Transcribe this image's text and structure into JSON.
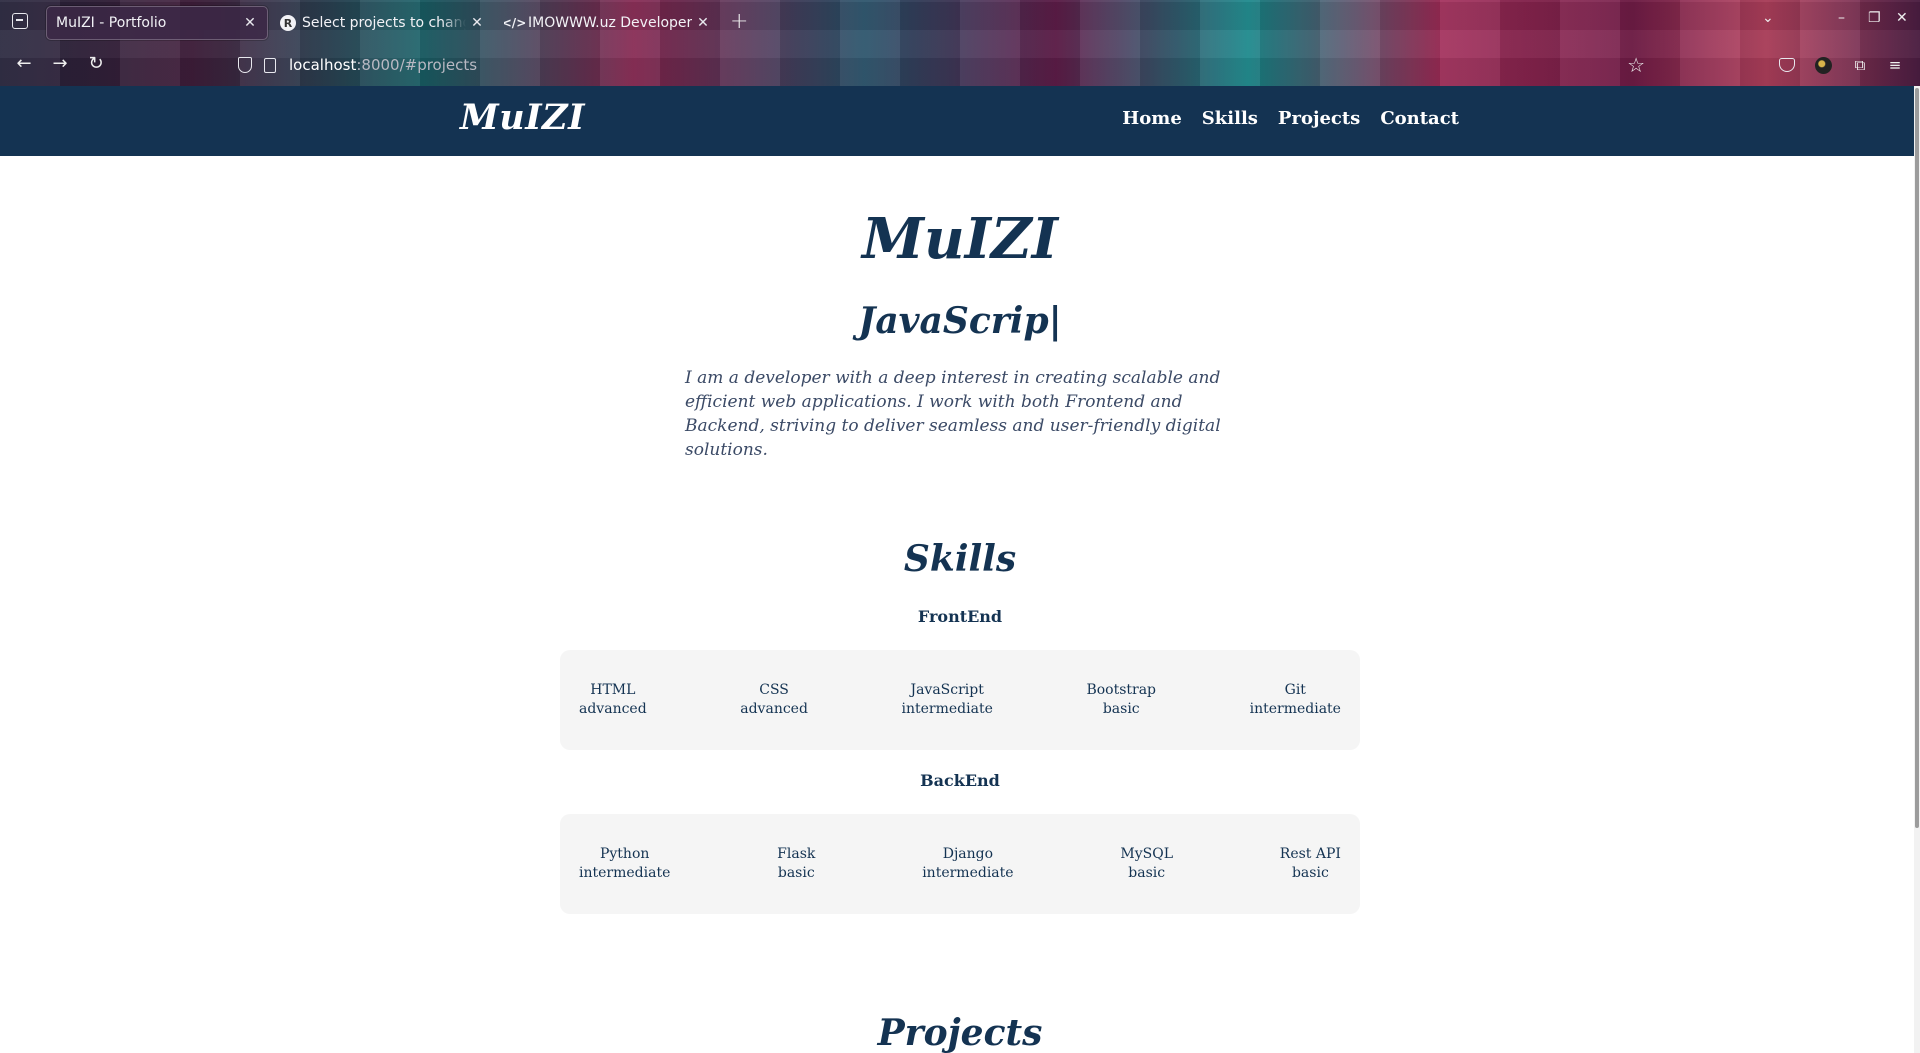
{
  "browser": {
    "tabs": [
      {
        "title": "MuIZI - Portfolio",
        "active": true
      },
      {
        "title": "Select projects to change",
        "favicon": "R",
        "active": false
      },
      {
        "title": "IMOWWW.uz Developer",
        "favicon": "</>",
        "active": false
      }
    ],
    "url_host": "localhost",
    "url_rest": ":8000/#projects"
  },
  "site": {
    "brand": "MuIZI",
    "menu": [
      "Home",
      "Skills",
      "Projects",
      "Contact"
    ]
  },
  "hero": {
    "title": "MuIZI",
    "typed_text": "JavaScrip|",
    "about": "I am a developer with a deep interest in creating scalable and efficient web applications. I work with both Frontend and Backend, striving to deliver seamless and user-friendly digital solutions."
  },
  "skills": {
    "title": "Skills",
    "groups": [
      {
        "name": "FrontEnd",
        "items": [
          {
            "name": "HTML",
            "level": "advanced"
          },
          {
            "name": "CSS",
            "level": "advanced"
          },
          {
            "name": "JavaScript",
            "level": "intermediate"
          },
          {
            "name": "Bootstrap",
            "level": "basic"
          },
          {
            "name": "Git",
            "level": "intermediate"
          }
        ]
      },
      {
        "name": "BackEnd",
        "items": [
          {
            "name": "Python",
            "level": "intermediate"
          },
          {
            "name": "Flask",
            "level": "basic"
          },
          {
            "name": "Django",
            "level": "intermediate"
          },
          {
            "name": "MySQL",
            "level": "basic"
          },
          {
            "name": "Rest API",
            "level": "basic"
          }
        ]
      }
    ]
  },
  "projects": {
    "title": "Projects"
  }
}
